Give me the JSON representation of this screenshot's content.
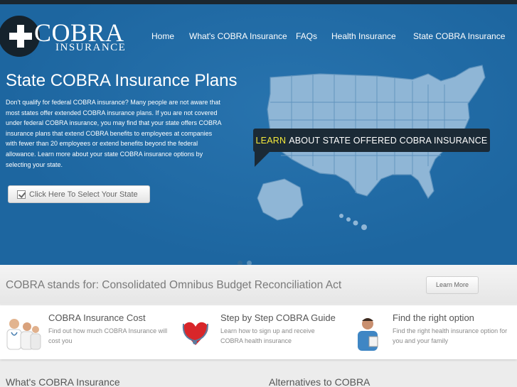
{
  "brand": {
    "logo_word": "COBRA",
    "logo_sub": "INSURANCE"
  },
  "nav": [
    {
      "label": "Home"
    },
    {
      "label": "What's COBRA Insurance"
    },
    {
      "label": "FAQs"
    },
    {
      "label": "Health Insurance"
    },
    {
      "label": "State COBRA Insurance"
    }
  ],
  "hero": {
    "title": "State COBRA Insurance Plans",
    "body": "Don't qualify for federal COBRA insurance? Many people are not aware that most states offer extended COBRA insurance plans. If you are not covered under federal COBRA insurance, you may find that your state offers COBRA insurance plans that extend COBRA benefits to employees at companies with fewer than 20 employees or extend benefits beyond the federal allowance. Learn more about your state COBRA insurance options by selecting your state.",
    "button_label": "Click Here To Select Your State",
    "banner_highlight": "LEARN",
    "banner_text": "ABOUT STATE OFFERED COBRA INSURANCE"
  },
  "stands": {
    "text": "COBRA stands for: Consolidated Omnibus Budget Reconciliation Act",
    "button_label": "Learn More"
  },
  "features": [
    {
      "title": "COBRA Insurance Cost",
      "desc": "Find out how much COBRA Insurance will cost you"
    },
    {
      "title": "Step by Step COBRA Guide",
      "desc": "Learn how to sign up and receive COBRA health insurance"
    },
    {
      "title": "Find the right option",
      "desc": "Find the right health insurance option for you and your family"
    }
  ],
  "sections": [
    {
      "title": "What's COBRA Insurance"
    },
    {
      "title": "Alternatives to COBRA"
    }
  ],
  "colors": {
    "hero_bg": "#1d66a0",
    "banner_bg": "#1b2a36",
    "highlight": "#f6ea3b",
    "map_fill": "#8fb6d6"
  },
  "icons": {
    "logo": "cross-logo-icon",
    "select": "checkbox-icon"
  }
}
